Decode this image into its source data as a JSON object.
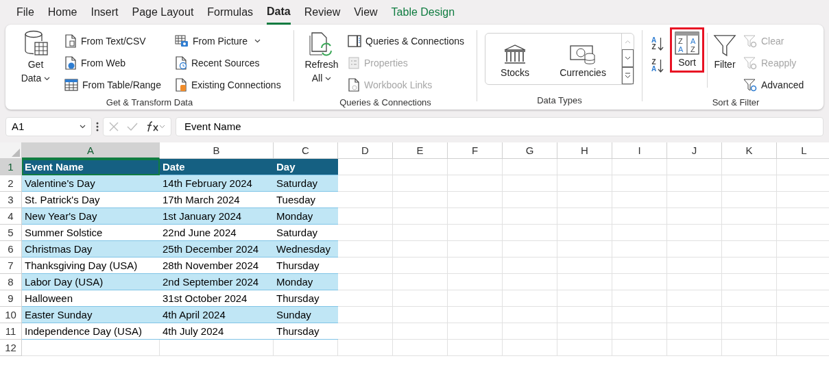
{
  "menu_tabs": [
    {
      "label": "File",
      "selected": false,
      "kind": "normal"
    },
    {
      "label": "Home",
      "selected": false,
      "kind": "normal"
    },
    {
      "label": "Insert",
      "selected": false,
      "kind": "normal"
    },
    {
      "label": "Page Layout",
      "selected": false,
      "kind": "normal"
    },
    {
      "label": "Formulas",
      "selected": false,
      "kind": "normal"
    },
    {
      "label": "Data",
      "selected": true,
      "kind": "normal"
    },
    {
      "label": "Review",
      "selected": false,
      "kind": "normal"
    },
    {
      "label": "View",
      "selected": false,
      "kind": "normal"
    },
    {
      "label": "Table Design",
      "selected": false,
      "kind": "contextual"
    }
  ],
  "ribbon_groups": [
    {
      "title": "Get & Transform Data",
      "items": [
        {
          "label": "Get Data",
          "disabled": false
        },
        {
          "label": "From Text/CSV",
          "disabled": false
        },
        {
          "label": "From Web",
          "disabled": false
        },
        {
          "label": "From Table/Range",
          "disabled": false
        },
        {
          "label": "From Picture",
          "disabled": false
        },
        {
          "label": "Recent Sources",
          "disabled": false
        },
        {
          "label": "Existing Connections",
          "disabled": false
        }
      ]
    },
    {
      "title": "Queries & Connections",
      "items": [
        {
          "label": "Refresh All",
          "disabled": false
        },
        {
          "label": "Queries & Connections",
          "disabled": false
        },
        {
          "label": "Properties",
          "disabled": true
        },
        {
          "label": "Workbook Links",
          "disabled": true
        }
      ]
    },
    {
      "title": "Data Types",
      "items": [
        {
          "label": "Stocks",
          "disabled": false
        },
        {
          "label": "Currencies",
          "disabled": false
        }
      ]
    },
    {
      "title": "Sort & Filter",
      "items": [
        {
          "icon_letters": [
            "A",
            "Z"
          ],
          "disabled": false
        },
        {
          "icon_letters": [
            "Z",
            "A"
          ],
          "disabled": false
        },
        {
          "label": "Sort",
          "icon_letters": [
            "Z",
            "A",
            "A",
            "Z"
          ],
          "disabled": false,
          "highlighted": true
        },
        {
          "label": "Filter",
          "disabled": false
        },
        {
          "label": "Clear",
          "disabled": true
        },
        {
          "label": "Reapply",
          "disabled": true
        },
        {
          "label": "Advanced",
          "disabled": false
        }
      ]
    }
  ],
  "formula_bar": {
    "name_box": "A1",
    "formula": "Event Name"
  },
  "sheet": {
    "columns": [
      {
        "label": "A",
        "selected": true
      },
      {
        "label": "B",
        "selected": false
      },
      {
        "label": "C",
        "selected": false
      },
      {
        "label": "D",
        "selected": false
      },
      {
        "label": "E",
        "selected": false
      },
      {
        "label": "F",
        "selected": false
      },
      {
        "label": "G",
        "selected": false
      },
      {
        "label": "H",
        "selected": false
      },
      {
        "label": "I",
        "selected": false
      },
      {
        "label": "J",
        "selected": false
      },
      {
        "label": "K",
        "selected": false
      },
      {
        "label": "L",
        "selected": false
      }
    ],
    "rows": [
      {
        "number": "1",
        "selected": true,
        "kind": "header",
        "cells": [
          "Event Name",
          "Date",
          "Day"
        ]
      },
      {
        "number": "2",
        "selected": false,
        "kind": "data",
        "cells": [
          "Valentine's Day",
          "14th February 2024",
          "Saturday"
        ]
      },
      {
        "number": "3",
        "selected": false,
        "kind": "data",
        "cells": [
          "St. Patrick's Day",
          "17th March 2024",
          "Tuesday"
        ]
      },
      {
        "number": "4",
        "selected": false,
        "kind": "data",
        "cells": [
          "New Year's Day",
          "1st January 2024",
          "Monday"
        ]
      },
      {
        "number": "5",
        "selected": false,
        "kind": "data",
        "cells": [
          "Summer Solstice",
          "22nd June 2024",
          "Saturday"
        ]
      },
      {
        "number": "6",
        "selected": false,
        "kind": "data",
        "cells": [
          "Christmas Day",
          "25th December 2024",
          "Wednesday"
        ]
      },
      {
        "number": "7",
        "selected": false,
        "kind": "data",
        "cells": [
          "Thanksgiving Day (USA)",
          "28th November 2024",
          "Thursday"
        ]
      },
      {
        "number": "8",
        "selected": false,
        "kind": "data",
        "cells": [
          "Labor Day (USA)",
          "2nd September 2024",
          "Monday"
        ]
      },
      {
        "number": "9",
        "selected": false,
        "kind": "data",
        "cells": [
          "Halloween",
          "31st October 2024",
          "Thursday"
        ]
      },
      {
        "number": "10",
        "selected": false,
        "kind": "data",
        "cells": [
          "Easter Sunday",
          "4th April 2024",
          "Sunday"
        ]
      },
      {
        "number": "11",
        "selected": false,
        "kind": "data",
        "cells": [
          "Independence Day (USA)",
          "4th July 2024",
          "Thursday"
        ]
      },
      {
        "number": "12",
        "selected": false,
        "kind": "empty"
      }
    ]
  }
}
